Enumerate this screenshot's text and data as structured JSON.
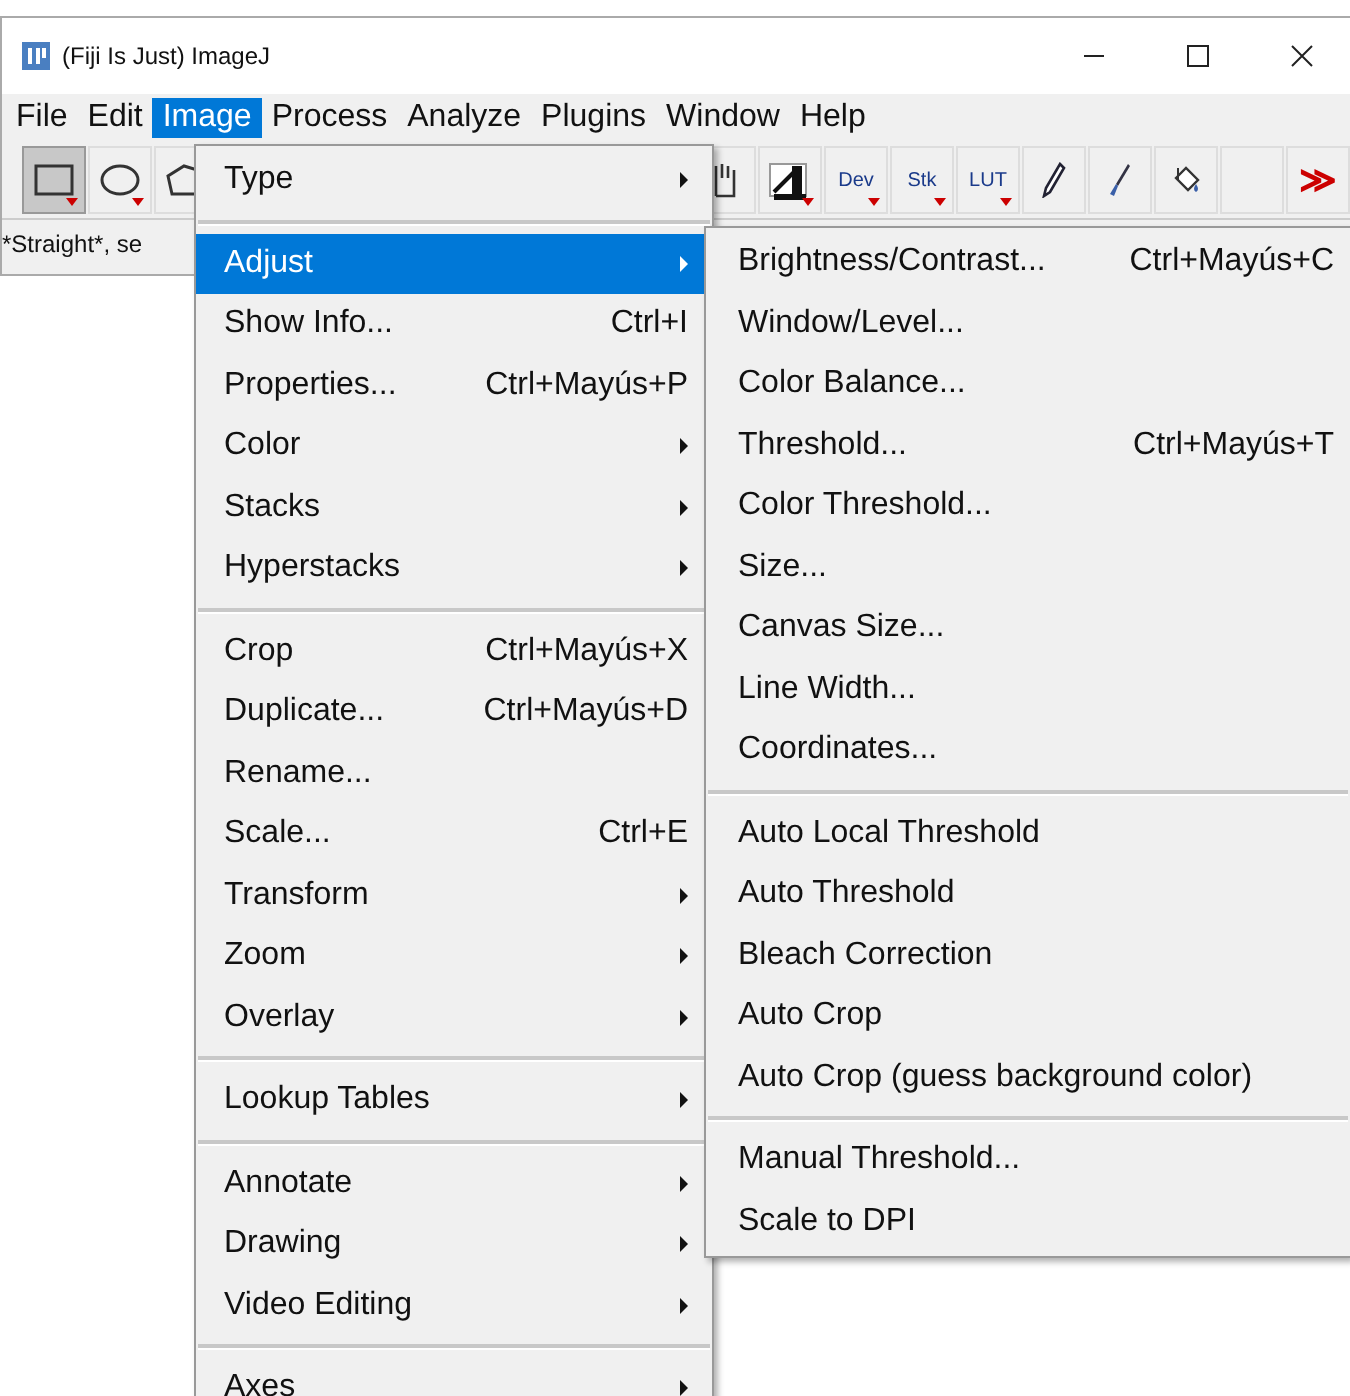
{
  "window": {
    "title": "(Fiji Is Just) ImageJ"
  },
  "menubar": [
    {
      "label": "File",
      "selected": false
    },
    {
      "label": "Edit",
      "selected": false
    },
    {
      "label": "Image",
      "selected": true
    },
    {
      "label": "Process",
      "selected": false
    },
    {
      "label": "Analyze",
      "selected": false
    },
    {
      "label": "Plugins",
      "selected": false
    },
    {
      "label": "Window",
      "selected": false
    },
    {
      "label": "Help",
      "selected": false
    }
  ],
  "toolbar_left": [
    {
      "kind": "rect",
      "selected": true,
      "dropdown": true
    },
    {
      "kind": "oval",
      "selected": false,
      "dropdown": true
    },
    {
      "kind": "polygon",
      "selected": false
    }
  ],
  "toolbar_right": [
    {
      "kind": "hand",
      "selected": false,
      "dropdown": false
    },
    {
      "kind": "line-tool",
      "selected": false,
      "dropdown": true
    },
    {
      "kind": "text",
      "label": "Dev",
      "selected": false,
      "dropdown": true
    },
    {
      "kind": "text",
      "label": "Stk",
      "selected": false,
      "dropdown": true
    },
    {
      "kind": "text",
      "label": "LUT",
      "selected": false,
      "dropdown": true
    },
    {
      "kind": "pencil",
      "selected": false,
      "dropdown": false
    },
    {
      "kind": "brush",
      "selected": false,
      "dropdown": false
    },
    {
      "kind": "bucket",
      "selected": false,
      "dropdown": false
    },
    {
      "kind": "blank",
      "selected": false,
      "dropdown": false
    },
    {
      "kind": "more",
      "label": "≫",
      "selected": false,
      "dropdown": false
    }
  ],
  "status_bar": "*Straight*, se",
  "image_menu": [
    [
      {
        "label": "Type",
        "submenu": true,
        "selected": false
      }
    ],
    [
      {
        "label": "Adjust",
        "submenu": true,
        "selected": true
      },
      {
        "label": "Show Info...",
        "shortcut": "Ctrl+I",
        "submenu": false,
        "selected": false
      },
      {
        "label": "Properties...",
        "shortcut": "Ctrl+Mayús+P",
        "submenu": false,
        "selected": false
      },
      {
        "label": "Color",
        "submenu": true,
        "selected": false
      },
      {
        "label": "Stacks",
        "submenu": true,
        "selected": false
      },
      {
        "label": "Hyperstacks",
        "submenu": true,
        "selected": false
      }
    ],
    [
      {
        "label": "Crop",
        "shortcut": "Ctrl+Mayús+X",
        "submenu": false,
        "selected": false
      },
      {
        "label": "Duplicate...",
        "shortcut": "Ctrl+Mayús+D",
        "submenu": false,
        "selected": false
      },
      {
        "label": "Rename...",
        "submenu": false,
        "selected": false
      },
      {
        "label": "Scale...",
        "shortcut": "Ctrl+E",
        "submenu": false,
        "selected": false
      },
      {
        "label": "Transform",
        "submenu": true,
        "selected": false
      },
      {
        "label": "Zoom",
        "submenu": true,
        "selected": false
      },
      {
        "label": "Overlay",
        "submenu": true,
        "selected": false
      }
    ],
    [
      {
        "label": "Lookup Tables",
        "submenu": true,
        "selected": false
      }
    ],
    [
      {
        "label": "Annotate",
        "submenu": true,
        "selected": false
      },
      {
        "label": "Drawing",
        "submenu": true,
        "selected": false
      },
      {
        "label": "Video Editing",
        "submenu": true,
        "selected": false
      }
    ],
    [
      {
        "label": "Axes",
        "submenu": true,
        "selected": false
      }
    ]
  ],
  "adjust_submenu": [
    [
      {
        "label": "Brightness/Contrast...",
        "shortcut": "Ctrl+Mayús+C",
        "selected": false
      },
      {
        "label": "Window/Level...",
        "selected": false
      },
      {
        "label": "Color Balance...",
        "selected": false
      },
      {
        "label": "Threshold...",
        "shortcut": "Ctrl+Mayús+T",
        "selected": false
      },
      {
        "label": "Color Threshold...",
        "selected": false
      },
      {
        "label": "Size...",
        "selected": false
      },
      {
        "label": "Canvas Size...",
        "selected": false
      },
      {
        "label": "Line Width...",
        "selected": false
      },
      {
        "label": "Coordinates...",
        "selected": false
      }
    ],
    [
      {
        "label": "Auto Local Threshold",
        "selected": false
      },
      {
        "label": "Auto Threshold",
        "selected": false
      },
      {
        "label": "Bleach Correction",
        "selected": false
      },
      {
        "label": "Auto Crop",
        "selected": false
      },
      {
        "label": "Auto Crop (guess background color)",
        "selected": false
      }
    ],
    [
      {
        "label": "Manual Threshold...",
        "selected": false
      },
      {
        "label": "Scale to DPI",
        "selected": false
      }
    ]
  ]
}
